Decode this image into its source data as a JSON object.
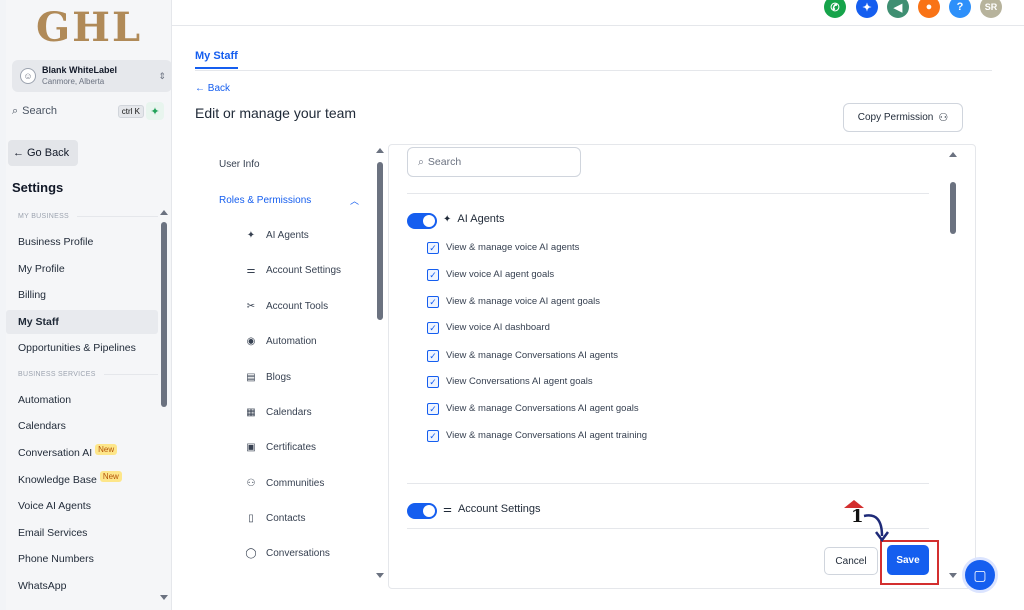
{
  "sidebar": {
    "logo": "GHL",
    "account_name": "Blank WhiteLabel",
    "account_location": "Canmore, Alberta",
    "search_label": "Search",
    "search_shortcut": "ctrl K",
    "go_back": "Go Back",
    "settings_title": "Settings",
    "section_my_business": "MY BUSINESS",
    "section_business_services": "BUSINESS SERVICES",
    "items": [
      {
        "label": "Business Profile"
      },
      {
        "label": "My Profile"
      },
      {
        "label": "Billing"
      },
      {
        "label": "My Staff"
      },
      {
        "label": "Opportunities & Pipelines"
      },
      {
        "label": "Automation"
      },
      {
        "label": "Calendars"
      },
      {
        "label": "Conversation AI",
        "badge": "New"
      },
      {
        "label": "Knowledge Base",
        "badge": "New"
      },
      {
        "label": "Voice AI Agents"
      },
      {
        "label": "Email Services"
      },
      {
        "label": "Phone Numbers"
      },
      {
        "label": "WhatsApp"
      }
    ],
    "active": "My Staff"
  },
  "header": {
    "icons": [
      {
        "name": "phone-icon",
        "color": "#16a34a",
        "glyph": "✆"
      },
      {
        "name": "magic-icon",
        "color": "#155eef",
        "glyph": "✦"
      },
      {
        "name": "megaphone-icon",
        "color": "#3f8f72",
        "glyph": "◀"
      },
      {
        "name": "bell-icon",
        "color": "#f97316",
        "glyph": "●"
      },
      {
        "name": "help-icon",
        "color": "#2e90fa",
        "glyph": "?"
      }
    ],
    "avatar_initials": "SR"
  },
  "main": {
    "tab": "My Staff",
    "back": "Back",
    "title": "Edit or manage your team",
    "copy_permission": "Copy Permission"
  },
  "permission_menu": {
    "user_info": "User Info",
    "roles_permissions": "Roles & Permissions",
    "items": [
      "AI Agents",
      "Account Settings",
      "Account Tools",
      "Automation",
      "Blogs",
      "Calendars",
      "Certificates",
      "Communities",
      "Contacts",
      "Conversations"
    ]
  },
  "panel": {
    "search_placeholder": "Search",
    "group1": {
      "title": "AI Agents",
      "permissions": [
        "View & manage voice AI agents",
        "View voice AI agent goals",
        "View & manage voice AI agent goals",
        "View voice AI dashboard",
        "View & manage Conversations AI agents",
        "View Conversations AI agent goals",
        "View & manage Conversations AI agent goals",
        "View & manage Conversations AI agent training"
      ]
    },
    "group2": {
      "title": "Account Settings"
    }
  },
  "actions": {
    "cancel": "Cancel",
    "save": "Save",
    "step_marker": "1"
  },
  "colors": {
    "accent": "#155eef",
    "highlight": "#d32f2f"
  }
}
